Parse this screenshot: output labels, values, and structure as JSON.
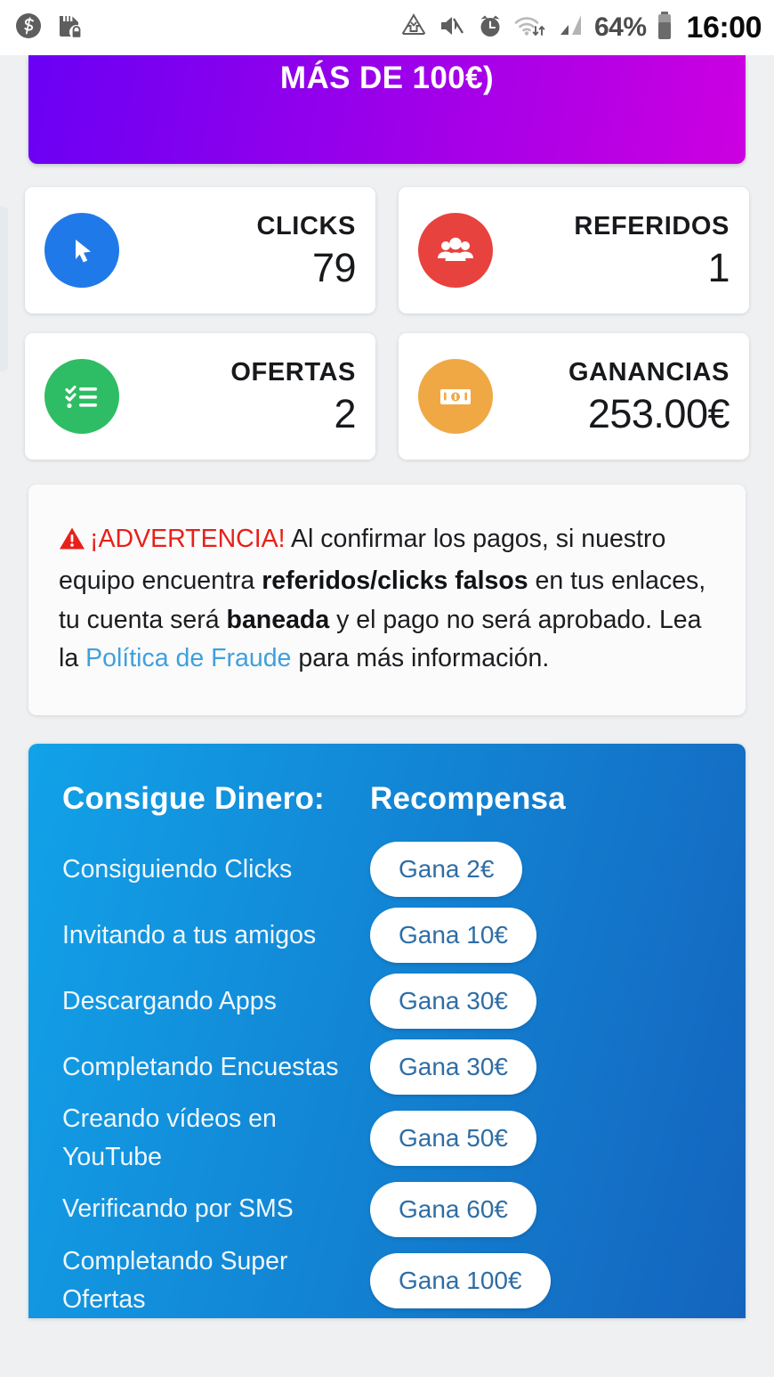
{
  "status_bar": {
    "left_icons": [
      "circled-s-icon",
      "sd-card-lock-icon"
    ],
    "right_icons": [
      "data-saver-icon",
      "volume-mute-icon",
      "alarm-clock-icon",
      "wifi-transfer-icon",
      "signal-bars-icon"
    ],
    "battery_percent": "64%",
    "battery_icon": "battery-icon",
    "time": "16:00"
  },
  "promo_banner": {
    "text": "MÁS DE 100€)",
    "gradient_start": "#6a00f4",
    "gradient_end": "#cc00e0"
  },
  "stats": [
    {
      "icon": "cursor-arrow-icon",
      "label": "CLICKS",
      "value": "79",
      "color": "#2079e8"
    },
    {
      "icon": "people-group-icon",
      "label": "REFERIDOS",
      "value": "1",
      "color": "#e8423f"
    },
    {
      "icon": "checklist-icon",
      "label": "OFERTAS",
      "value": "2",
      "color": "#2ebd64"
    },
    {
      "icon": "banknote-icon",
      "label": "GANANCIAS",
      "value": "253.00€",
      "color": "#f0a845"
    }
  ],
  "warning": {
    "icon": "warning-triangle-icon",
    "heading": "¡ADVERTENCIA!",
    "part1": " Al confirmar los pagos, si nuestro equipo encuentra ",
    "bold1": "referidos/clicks falsos",
    "part2": " en tus enlaces, tu cuenta será ",
    "bold2": "baneada",
    "part3": " y el pago no será aprobado. Lea la ",
    "link": "Política de Fraude",
    "part4": " para más información.",
    "heading_color": "#e8201a",
    "link_color": "#3fa0dd"
  },
  "rewards": {
    "header_task": "Consigue Dinero:",
    "header_reward": "Recompensa",
    "gradient_start": "#11a2e8",
    "gradient_end": "#1464bd",
    "rows": [
      {
        "task": "Consiguiendo Clicks",
        "reward": "Gana 2€"
      },
      {
        "task": "Invitando a tus amigos",
        "reward": "Gana 10€"
      },
      {
        "task": "Descargando Apps",
        "reward": "Gana 30€"
      },
      {
        "task": "Completando Encuestas",
        "reward": "Gana 30€"
      },
      {
        "task": "Creando vídeos en YouTube",
        "reward": "Gana 50€"
      },
      {
        "task": "Verificando por SMS",
        "reward": "Gana 60€"
      },
      {
        "task": "Completando Super Ofertas",
        "reward": "Gana 100€"
      }
    ]
  }
}
